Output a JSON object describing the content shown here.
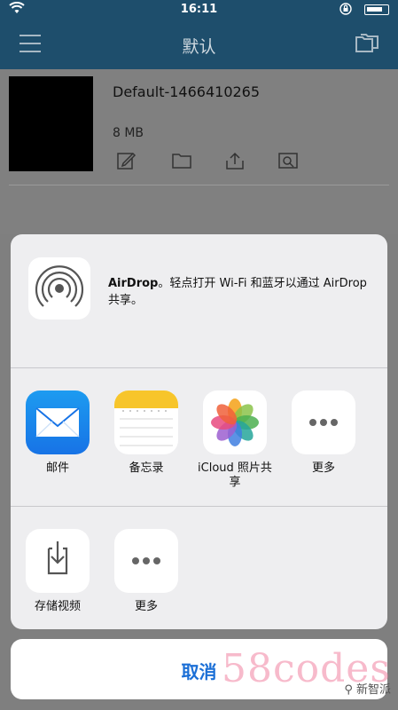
{
  "status_bar": {
    "time": "16:11"
  },
  "nav": {
    "title": "默认"
  },
  "file": {
    "name": "Default-1466410265",
    "size": "8 MB"
  },
  "share_sheet": {
    "airdrop": {
      "title": "AirDrop",
      "description": "。轻点打开 Wi-Fi 和蓝牙以通过 AirDrop 共享。"
    },
    "apps": [
      {
        "label": "邮件",
        "icon": "mail-icon"
      },
      {
        "label": "备忘录",
        "icon": "notes-icon"
      },
      {
        "label": "iCloud 照片共享",
        "icon": "photos-icon"
      },
      {
        "label": "更多",
        "icon": "more-icon"
      }
    ],
    "actions": [
      {
        "label": "存储视频",
        "icon": "save-video-icon"
      },
      {
        "label": "更多",
        "icon": "more-icon"
      }
    ],
    "cancel_label": "取消"
  },
  "watermark": {
    "text": "58codes",
    "badge": "⚲ 新智派"
  },
  "colors": {
    "nav_bg": "#1e4e6c",
    "cancel_text": "#1b6fd6",
    "sheet_bg": "#eeeef0"
  }
}
